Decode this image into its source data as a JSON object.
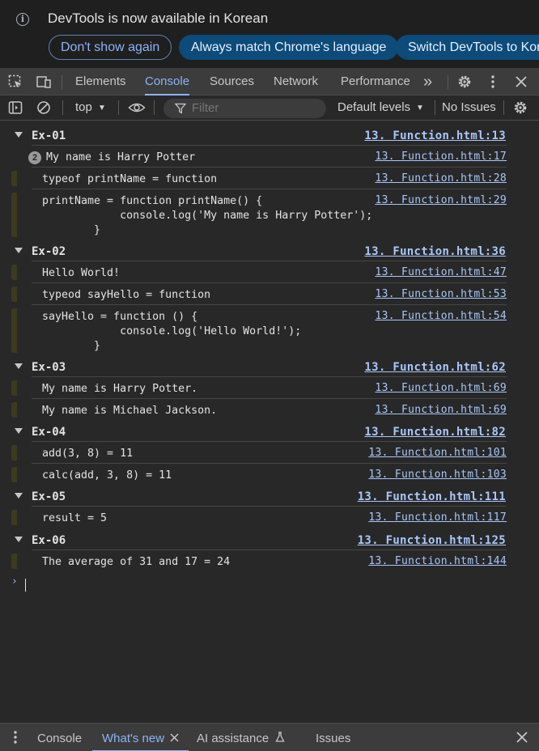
{
  "infobar": {
    "message": "DevTools is now available in Korean",
    "dont_show": "Don't show again",
    "always_match": "Always match Chrome's language",
    "switch": "Switch DevTools to Kore"
  },
  "tabs": {
    "elements": "Elements",
    "console": "Console",
    "sources": "Sources",
    "network": "Network",
    "performance": "Performance",
    "more": "»"
  },
  "toolbar": {
    "context": "top",
    "filter_placeholder": "Filter",
    "levels": "Default levels",
    "issues": "No Issues"
  },
  "groups": [
    {
      "label": "Ex-01",
      "link": "13. Function.html:13",
      "rows": [
        {
          "badge": "2",
          "msg": "My name is Harry Potter",
          "link": "13. Function.html:17"
        },
        {
          "msg": "typeof printName = function",
          "link": "13. Function.html:28"
        },
        {
          "msg": "printName = function printName() {\n            console.log('My name is Harry Potter');\n        }",
          "link": "13. Function.html:29"
        }
      ]
    },
    {
      "label": "Ex-02",
      "link": "13. Function.html:36",
      "rows": [
        {
          "msg": "Hello World!",
          "link": "13. Function.html:47"
        },
        {
          "msg": "typeod sayHello = function",
          "link": "13. Function.html:53"
        },
        {
          "msg": "sayHello = function () {\n            console.log('Hello World!');\n        }",
          "link": "13. Function.html:54"
        }
      ]
    },
    {
      "label": "Ex-03",
      "link": "13. Function.html:62",
      "rows": [
        {
          "msg": "My name is Harry Potter.",
          "link": "13. Function.html:69"
        },
        {
          "msg": "My name is Michael Jackson.",
          "link": "13. Function.html:69"
        }
      ]
    },
    {
      "label": "Ex-04",
      "link": "13. Function.html:82",
      "rows": [
        {
          "msg": "add(3, 8) = 11",
          "link": "13. Function.html:101"
        },
        {
          "msg": "calc(add, 3, 8) = 11",
          "link": "13. Function.html:103"
        }
      ]
    },
    {
      "label": "Ex-05",
      "link": "13. Function.html:111",
      "rows": [
        {
          "msg": "result = 5",
          "link": "13. Function.html:117"
        }
      ]
    },
    {
      "label": "Ex-06",
      "link": "13. Function.html:125",
      "rows": [
        {
          "msg": "The average of 31 and 17 = 24",
          "link": "13. Function.html:144"
        }
      ]
    }
  ],
  "prompt": "›",
  "drawer": {
    "console": "Console",
    "whats_new": "What's new",
    "ai": "AI assistance",
    "issues": "Issues"
  }
}
